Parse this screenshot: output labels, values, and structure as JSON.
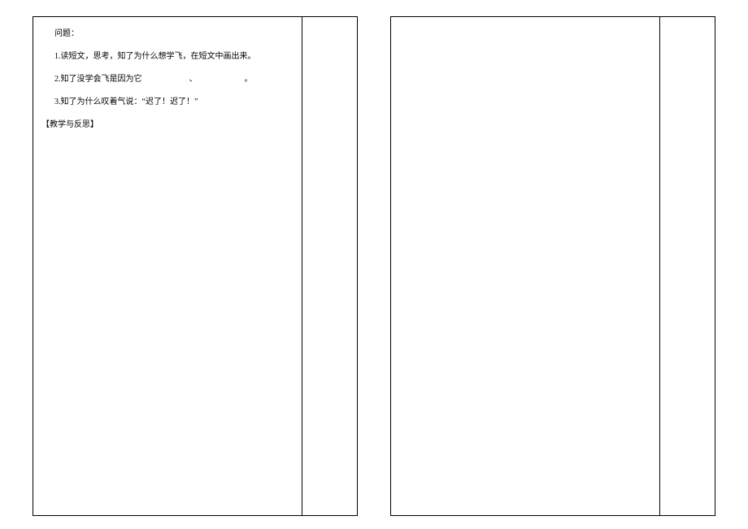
{
  "left": {
    "heading": "问题：",
    "q1": "1.读短文，思考，知了为什么想学飞，在短文中画出来。",
    "q2_prefix": "2.知了没学会飞是因为它",
    "q2_sep1": "、",
    "q2_sep2": "。",
    "q3": "3.知了为什么叹着气说：“迟了！迟了！”",
    "section": "【教学与反思】"
  }
}
